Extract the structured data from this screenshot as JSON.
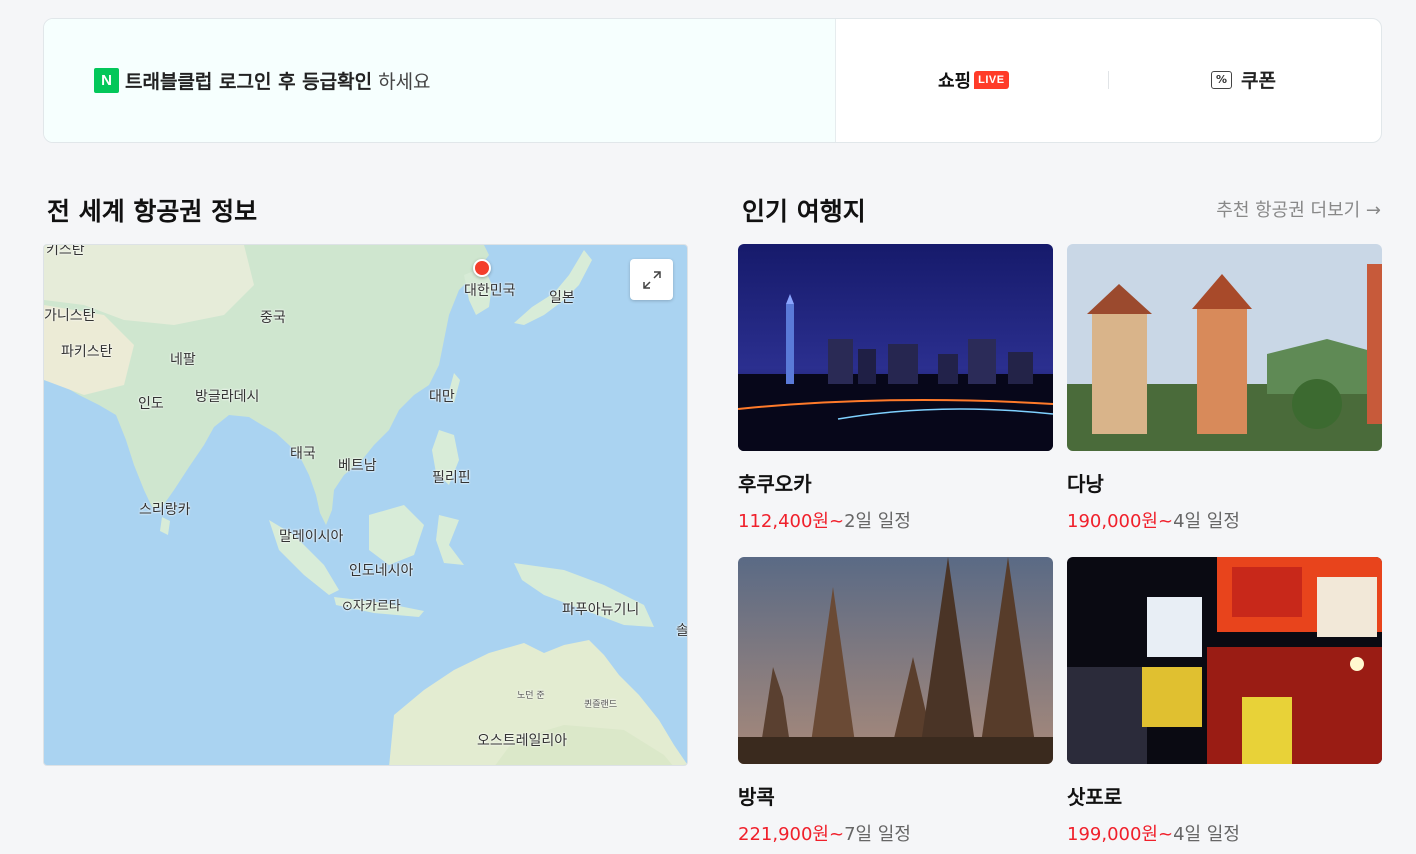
{
  "banner": {
    "login_bold": "트래블클럽 로그인 후 등급확인",
    "login_tail": "하세요",
    "naver_logo": "N",
    "shopping": "쇼핑",
    "live_badge": "LIVE",
    "coupon_icon": "%",
    "coupon": "쿠폰"
  },
  "map_section": {
    "title": "전 세계 항공권 정보",
    "labels": [
      {
        "text": "키스탄"
      },
      {
        "text": "대한민국"
      },
      {
        "text": "일본"
      },
      {
        "text": "가니스탄"
      },
      {
        "text": "중국"
      },
      {
        "text": "파키스탄"
      },
      {
        "text": "네팔"
      },
      {
        "text": "인도"
      },
      {
        "text": "방글라데시"
      },
      {
        "text": "대만"
      },
      {
        "text": "태국"
      },
      {
        "text": "베트남"
      },
      {
        "text": "필리핀"
      },
      {
        "text": "스리랑카"
      },
      {
        "text": "말레이시아"
      },
      {
        "text": "인도네시아"
      },
      {
        "text": "⊙자카르타"
      },
      {
        "text": "파푸아뉴기니"
      },
      {
        "text": "솔"
      },
      {
        "text": "노던 준"
      },
      {
        "text": "퀸즐랜드"
      },
      {
        "text": "오스트레일리아"
      }
    ]
  },
  "popular": {
    "title": "인기 여행지",
    "more": "추천 항공권 더보기 →",
    "destinations": [
      {
        "name": "후쿠오카",
        "price": "112,400원~",
        "duration": "2일 일정"
      },
      {
        "name": "다낭",
        "price": "190,000원~",
        "duration": "4일 일정"
      },
      {
        "name": "방콕",
        "price": "221,900원~",
        "duration": "7일 일정"
      },
      {
        "name": "삿포로",
        "price": "199,000원~",
        "duration": "4일 일정"
      }
    ]
  }
}
